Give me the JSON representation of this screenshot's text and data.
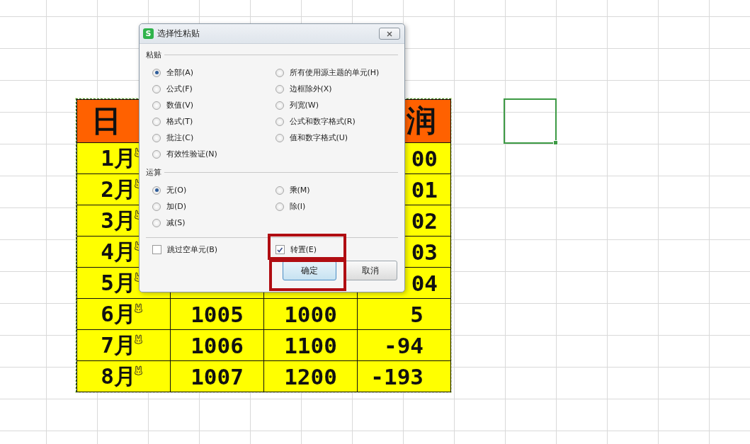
{
  "sheet": {
    "header": {
      "column_1": "日",
      "column_4": "润"
    },
    "rows": [
      {
        "column_1": "1月",
        "column_4": "00"
      },
      {
        "column_1": "2月",
        "column_4": "01"
      },
      {
        "column_1": "3月",
        "column_4": "02"
      },
      {
        "column_1": "4月",
        "column_4": "03"
      },
      {
        "column_1": "5月",
        "column_4": "04"
      },
      {
        "column_1": "6月",
        "column_2": "1005",
        "column_3": "1000",
        "column_4": "5"
      },
      {
        "column_1": "7月",
        "column_2": "1006",
        "column_3": "1100",
        "column_4": "-94"
      },
      {
        "column_1": "8月",
        "column_2": "1007",
        "column_3": "1200",
        "column_4": "-193"
      }
    ]
  },
  "dialog": {
    "app_icon_letter": "S",
    "title": "选择性粘贴",
    "sections": [
      {
        "label": "粘贴",
        "columns": [
          [
            {
              "label": "全部(A)",
              "selected": true
            },
            {
              "label": "公式(F)",
              "selected": false
            },
            {
              "label": "数值(V)",
              "selected": false
            },
            {
              "label": "格式(T)",
              "selected": false
            },
            {
              "label": "批注(C)",
              "selected": false
            },
            {
              "label": "有效性验证(N)",
              "selected": false
            }
          ],
          [
            {
              "label": "所有使用源主题的单元(H)",
              "selected": false
            },
            {
              "label": "边框除外(X)",
              "selected": false
            },
            {
              "label": "列宽(W)",
              "selected": false
            },
            {
              "label": "公式和数字格式(R)",
              "selected": false
            },
            {
              "label": "值和数字格式(U)",
              "selected": false
            }
          ]
        ]
      },
      {
        "label": "运算",
        "columns": [
          [
            {
              "label": "无(O)",
              "selected": true
            },
            {
              "label": "加(D)",
              "selected": false
            },
            {
              "label": "减(S)",
              "selected": false
            }
          ],
          [
            {
              "label": "乘(M)",
              "selected": false
            },
            {
              "label": "除(I)",
              "selected": false
            }
          ]
        ]
      }
    ],
    "checkboxes": [
      {
        "label": "跳过空单元(B)",
        "checked": false
      },
      {
        "label": "转置(E)",
        "checked": true
      }
    ],
    "buttons": [
      {
        "label": "确定",
        "default": true
      },
      {
        "label": "取消",
        "default": false
      }
    ]
  }
}
